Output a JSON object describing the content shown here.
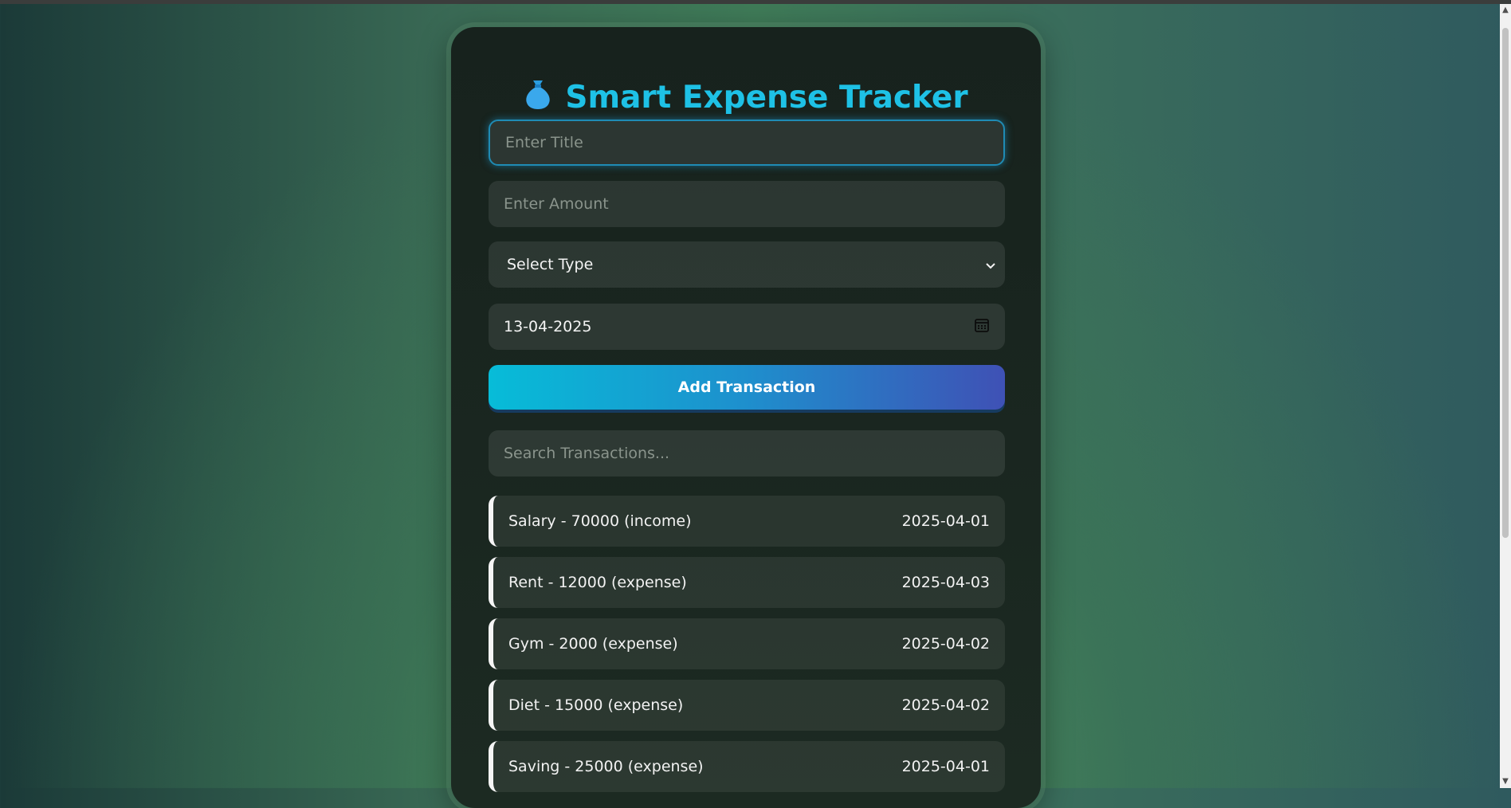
{
  "app": {
    "title": "Smart Expense Tracker",
    "title_icon": "money-bag-icon"
  },
  "form": {
    "title_placeholder": "Enter Title",
    "amount_placeholder": "Enter Amount",
    "type_selected": "Select Type",
    "date_value": "13-04-2025",
    "add_button_label": "Add Transaction"
  },
  "search": {
    "placeholder": "Search Transactions..."
  },
  "transactions": [
    {
      "text": "Salary - 70000 (income)",
      "date": "2025-04-01"
    },
    {
      "text": "Rent - 12000 (expense)",
      "date": "2025-04-03"
    },
    {
      "text": "Gym - 2000 (expense)",
      "date": "2025-04-02"
    },
    {
      "text": "Diet - 15000 (expense)",
      "date": "2025-04-02"
    },
    {
      "text": "Saving - 25000 (expense)",
      "date": "2025-04-01"
    }
  ],
  "colors": {
    "accent": "#1ec1e6",
    "button_start": "#07bcd8",
    "button_end": "#3f51b5"
  }
}
